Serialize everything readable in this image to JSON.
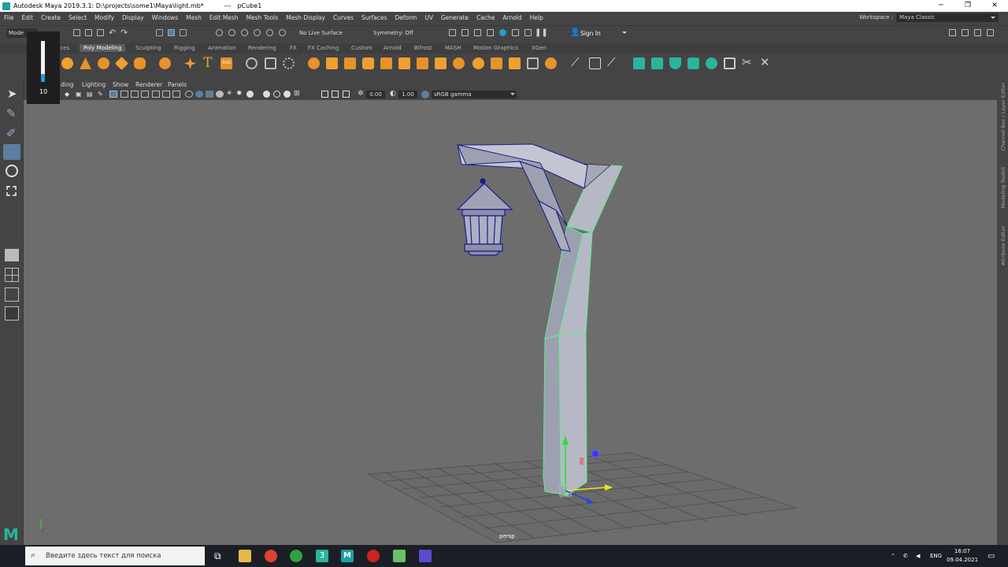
{
  "window": {
    "title": "Autodesk Maya 2019.3.1: D:\\projects\\some1\\Maya\\light.mb*",
    "separator": "---",
    "object": "pCube1",
    "controls": [
      "─",
      "❐",
      "✕"
    ]
  },
  "menu": [
    "File",
    "Edit",
    "Create",
    "Select",
    "Modify",
    "Display",
    "Windows",
    "Mesh",
    "Edit Mesh",
    "Mesh Tools",
    "Mesh Display",
    "Curves",
    "Surfaces",
    "Deform",
    "UV",
    "Generate",
    "Cache",
    "Arnold",
    "Help"
  ],
  "workspace": {
    "label": "Workspace :",
    "value": "Maya Classic"
  },
  "statusline": {
    "mode": "Mode",
    "live_surface": "No Live Surface",
    "symmetry": "Symmetry: Off",
    "signin": "Sign In"
  },
  "shelf_tabs": [
    "aces",
    "Poly Modeling",
    "Sculpting",
    "Rigging",
    "Animation",
    "Rendering",
    "FX",
    "FX Caching",
    "Custom",
    "Arnold",
    "Bifrost",
    "MASH",
    "Motion Graphics",
    "XGen"
  ],
  "shelf_active": "Poly Modeling",
  "brush_value": "10",
  "panel_menu": [
    "ding",
    "Lighting",
    "Show",
    "Renderer",
    "Panels"
  ],
  "panel_toolbar": {
    "exposure": "0.00",
    "gamma": "1.00",
    "colorspace": "sRGB gamma"
  },
  "viewport": {
    "camera": "persp"
  },
  "right_tabs": [
    "Channel Box / Layer Editor",
    "Modeling Toolkit",
    "Attribute Editor"
  ],
  "taskbar": {
    "search_placeholder": "Введите здесь текст для поиска",
    "lang": "ENG",
    "time": "16:07",
    "date": "09.04.2021"
  },
  "colors": {
    "viewport_bg": "#6d6d6d",
    "ui_bg": "#444444",
    "wire_selected": "#5cf08a",
    "wire_lantern": "#1a1a8a",
    "shelf_orange": "#f0a030",
    "shelf_teal": "#2ab49c"
  }
}
